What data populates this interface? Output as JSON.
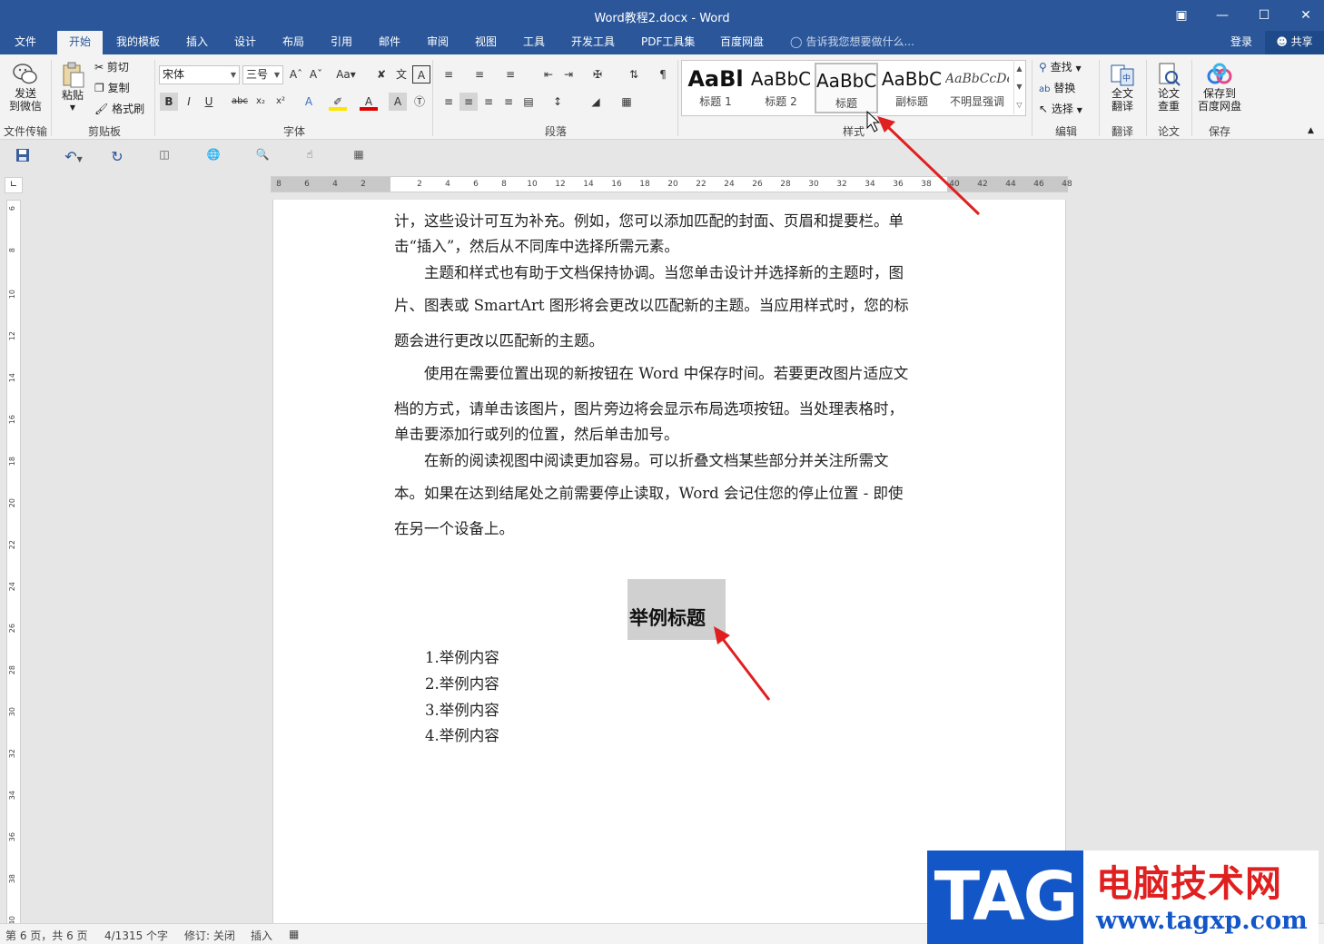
{
  "window": {
    "title": "Word教程2.docx - Word",
    "buttons": [
      "restore-icon",
      "minimize-icon",
      "maximize-icon",
      "close-icon"
    ]
  },
  "tabs": [
    {
      "label": "文件"
    },
    {
      "label": "开始",
      "active": true
    },
    {
      "label": "我的模板"
    },
    {
      "label": "插入"
    },
    {
      "label": "设计"
    },
    {
      "label": "布局"
    },
    {
      "label": "引用"
    },
    {
      "label": "邮件"
    },
    {
      "label": "审阅"
    },
    {
      "label": "视图"
    },
    {
      "label": "工具"
    },
    {
      "label": "开发工具"
    },
    {
      "label": "PDF工具集"
    },
    {
      "label": "百度网盘"
    }
  ],
  "tellme": "告诉我您想要做什么...",
  "account": {
    "login": "登录",
    "share": "共享"
  },
  "ribbon": {
    "wechat": {
      "label_line1": "发送",
      "label_line2": "到微信",
      "group": "文件传输"
    },
    "clipboard": {
      "paste": "粘贴",
      "cut": "剪切",
      "copy": "复制",
      "format_painter": "格式刷",
      "group": "剪贴板"
    },
    "font": {
      "name": "宋体",
      "size": "三号",
      "group": "字体"
    },
    "paragraph": {
      "group": "段落"
    },
    "styles": {
      "group": "样式",
      "items": [
        {
          "preview": "AaBl",
          "name": "标题 1"
        },
        {
          "preview": "AaBbC",
          "name": "标题 2"
        },
        {
          "preview": "AaBbC",
          "name": "标题",
          "selected": true
        },
        {
          "preview": "AaBbC",
          "name": "副标题"
        },
        {
          "preview": "AaBbCcDc",
          "name": "不明显强调"
        }
      ]
    },
    "editing": {
      "find": "查找",
      "replace": "替换",
      "select": "选择",
      "group": "编辑"
    },
    "translate": {
      "line1": "全文",
      "line2": "翻译",
      "group": "翻译"
    },
    "paper": {
      "line1": "论文",
      "line2": "查重",
      "group": "论文"
    },
    "save": {
      "line1": "保存到",
      "line2": "百度网盘",
      "group": "保存"
    }
  },
  "ruler": {
    "h_numbers": [
      "8",
      "6",
      "4",
      "2",
      "2",
      "4",
      "6",
      "8",
      "10",
      "12",
      "14",
      "16",
      "18",
      "20",
      "22",
      "24",
      "26",
      "28",
      "30",
      "32",
      "34",
      "36",
      "38",
      "40",
      "42",
      "44",
      "46",
      "48"
    ],
    "v_numbers": [
      "6",
      "8",
      "10",
      "12",
      "14",
      "16",
      "18",
      "20",
      "22",
      "24",
      "26",
      "28",
      "30",
      "32",
      "34",
      "36",
      "38",
      "40"
    ]
  },
  "document": {
    "paragraphs": [
      "计，这些设计可互为补充。例如，您可以添加匹配的封面、页眉和提要栏。单",
      "击“插入”，然后从不同库中选择所需元素。",
      "　　主题和样式也有助于文档保持协调。当您单击设计并选择新的主题时，图",
      "片、图表或 SmartArt 图形将会更改以匹配新的主题。当应用样式时，您的标",
      "题会进行更改以匹配新的主题。",
      "　　使用在需要位置出现的新按钮在 Word 中保存时间。若要更改图片适应文",
      "档的方式，请单击该图片，图片旁边将会显示布局选项按钮。当处理表格时，",
      "单击要添加行或列的位置，然后单击加号。",
      "　　在新的阅读视图中阅读更加容易。可以折叠文档某些部分并关注所需文",
      "本。如果在达到结尾处之前需要停止读取，Word 会记住您的停止位置 - 即使",
      "在另一个设备上。"
    ],
    "heading": "举例标题",
    "list": [
      "1.举例内容",
      "2.举例内容",
      "3.举例内容",
      "4.举例内容"
    ]
  },
  "status": {
    "page": "第 6 页，共 6 页",
    "words": "4/1315 个字",
    "track": "修订: 关闭",
    "mode": "插入"
  },
  "watermark": {
    "tag": "TAG",
    "site_name": "电脑技术网",
    "url": "www.tagxp.com"
  },
  "colors": {
    "accent": "#2b579a",
    "arrow": "#e02020"
  }
}
